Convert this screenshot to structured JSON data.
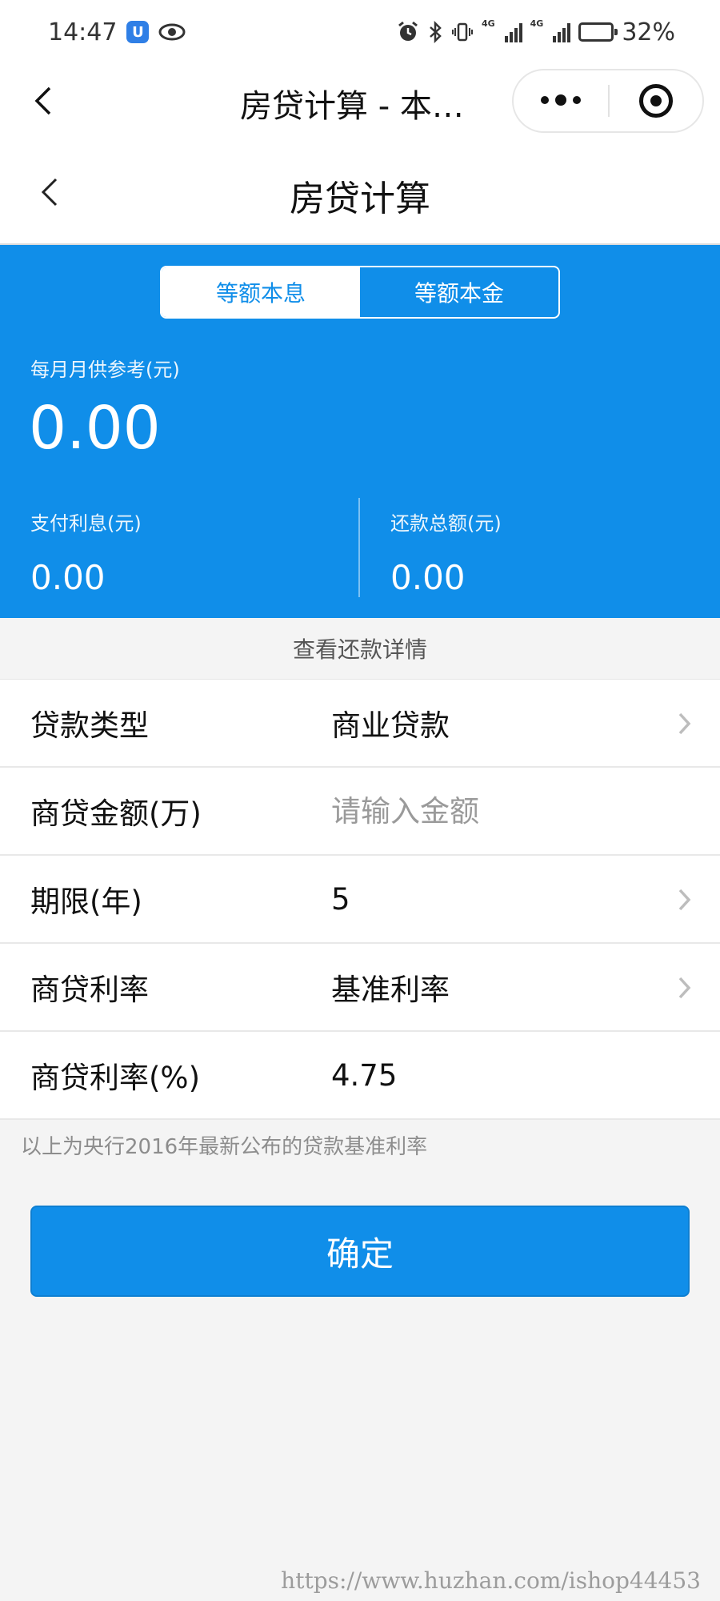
{
  "status_bar": {
    "time": "14:47",
    "battery": "32%",
    "battery_level": 0.32,
    "net_tag": "4G"
  },
  "nav": {
    "title": "房贷计算 - 本…",
    "icons": {
      "back": "chevron-left-icon",
      "more": "more-dots-icon",
      "close": "target-close-icon"
    }
  },
  "header": {
    "title": "房贷计算"
  },
  "summary": {
    "tabs": [
      {
        "label": "等额本息",
        "active": true
      },
      {
        "label": "等额本金",
        "active": false
      }
    ],
    "monthly_label": "每月月供参考(元)",
    "monthly_value": "0.00",
    "interest_label": "支付利息(元)",
    "interest_value": "0.00",
    "total_label": "还款总额(元)",
    "total_value": "0.00",
    "accent_color": "#108ee9"
  },
  "details_link": "查看还款详情",
  "form": {
    "loan_type": {
      "label": "贷款类型",
      "value": "商业贷款"
    },
    "amount": {
      "label": "商贷金额(万)",
      "placeholder": "请输入金额",
      "value": ""
    },
    "term": {
      "label": "期限(年)",
      "value": "5"
    },
    "rate_type": {
      "label": "商贷利率",
      "value": "基准利率"
    },
    "rate": {
      "label": "商贷利率(%)",
      "value": "4.75"
    }
  },
  "note": "以上为央行2016年最新公布的贷款基准利率",
  "confirm_label": "确定",
  "watermark": "https://www.huzhan.com/ishop44453"
}
